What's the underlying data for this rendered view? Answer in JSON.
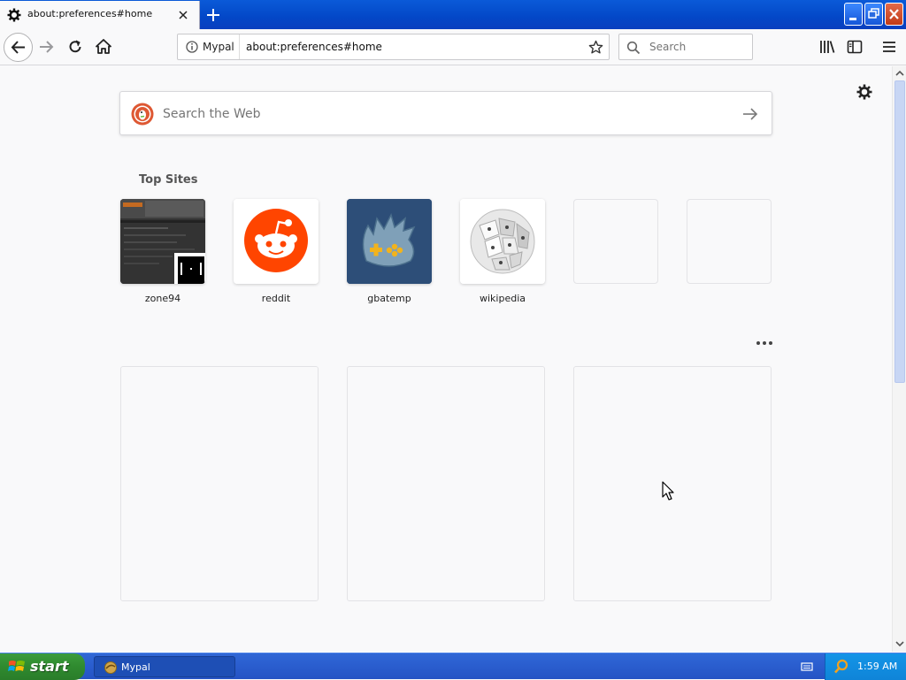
{
  "browser": {
    "tab": {
      "title": "about:preferences#home"
    },
    "identity_label": "Mypal",
    "url": "about:preferences#home",
    "search_placeholder": "Search"
  },
  "newtab": {
    "web_search_placeholder": "Search the Web",
    "top_sites_title": "Top Sites",
    "top_sites": [
      {
        "label": "zone94"
      },
      {
        "label": "reddit"
      },
      {
        "label": "gbatemp"
      },
      {
        "label": "wikipedia"
      },
      {
        "label": ""
      },
      {
        "label": ""
      }
    ]
  },
  "taskbar": {
    "start_label": "start",
    "task_label": "Mypal",
    "clock": "1:59 AM"
  },
  "colors": {
    "reddit": "#ff4500",
    "gbatemp": "#2d4e78",
    "xp_blue": "#0a5ad8",
    "start_green": "#3c9c3c"
  }
}
